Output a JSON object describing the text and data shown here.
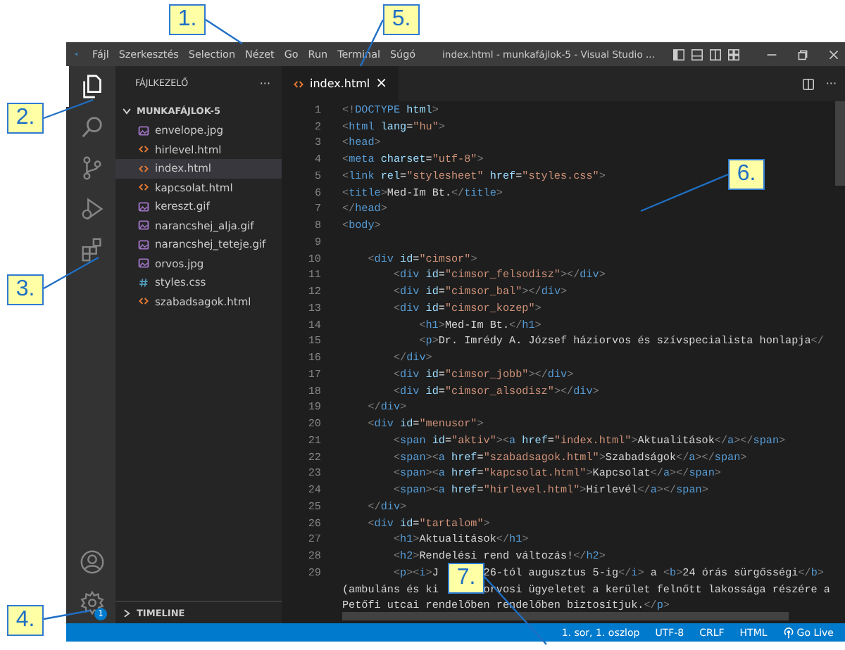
{
  "title_bar": {
    "menus": [
      "Fájl",
      "Szerkesztés",
      "Selection",
      "Nézet",
      "Go",
      "Run",
      "Terminal",
      "Súgó"
    ],
    "title": "index.html - munkafájlok-5 - Visual Studio ..."
  },
  "activity_bar": {
    "items": [
      {
        "kind": "explorer",
        "selected": true
      },
      {
        "kind": "search",
        "selected": false
      },
      {
        "kind": "source-control",
        "selected": false
      },
      {
        "kind": "run",
        "selected": false
      },
      {
        "kind": "extensions",
        "selected": false
      }
    ],
    "badge": "1"
  },
  "sidebar": {
    "title": "FÁJLKEZELŐ",
    "more": "···",
    "folder": {
      "name": "MUNKAFÁJLOK-5",
      "expanded": true,
      "files": [
        {
          "name": "envelope.jpg",
          "kind": "image",
          "selected": false
        },
        {
          "name": "hirlevel.html",
          "kind": "html",
          "selected": false
        },
        {
          "name": "index.html",
          "kind": "html",
          "selected": true
        },
        {
          "name": "kapcsolat.html",
          "kind": "html",
          "selected": false
        },
        {
          "name": "kereszt.gif",
          "kind": "image",
          "selected": false
        },
        {
          "name": "narancshej_alja.gif",
          "kind": "image",
          "selected": false
        },
        {
          "name": "narancshej_teteje.gif",
          "kind": "image",
          "selected": false
        },
        {
          "name": "orvos.jpg",
          "kind": "image",
          "selected": false
        },
        {
          "name": "styles.css",
          "kind": "css",
          "selected": false
        },
        {
          "name": "szabadsagok.html",
          "kind": "html",
          "selected": false
        }
      ]
    },
    "timeline": {
      "label": "TIMELINE",
      "expanded": false
    }
  },
  "tabs": [
    {
      "label": "index.html",
      "selected": true,
      "close": "×"
    }
  ],
  "editor_more": "···",
  "code_lines": [
    {
      "number": "1",
      "parts": [
        "<!DOCTYPE html>"
      ]
    },
    {
      "number": "2",
      "parts": [
        "<html lang=\"hu\">"
      ]
    },
    {
      "number": "3",
      "parts": [
        "<head>"
      ]
    },
    {
      "number": "4",
      "parts": [
        "<meta charset=\"utf-8\">"
      ]
    },
    {
      "number": "5",
      "parts": [
        "<link rel=\"stylesheet\" href=\"styles.css\">"
      ]
    },
    {
      "number": "6",
      "parts": [
        "<title>Med-Im Bt.</title>"
      ]
    },
    {
      "number": "7",
      "parts": [
        "</head>"
      ]
    },
    {
      "number": "8",
      "parts": [
        "<body>"
      ]
    },
    {
      "number": "9"
    },
    {
      "number": "10",
      "parts": [
        "    <div id=\"cimsor\">"
      ]
    },
    {
      "number": "11",
      "parts": [
        "        <div id=\"cimsor_felsodisz\"></div>"
      ]
    },
    {
      "number": "12",
      "parts": [
        "        <div id=\"cimsor_bal\"></div>"
      ]
    },
    {
      "number": "13",
      "parts": [
        "        <div id=\"cimsor_kozep\">"
      ]
    },
    {
      "number": "14",
      "parts": [
        "            <h1>Med-Im Bt.</h1>"
      ]
    },
    {
      "number": "15",
      "parts": [
        "            <p>Dr. Imrédy A. József háziorvos és szívspecialista honlapja</"
      ]
    },
    {
      "number": "16",
      "parts": [
        "        </div>"
      ]
    },
    {
      "number": "17",
      "parts": [
        "        <div id=\"cimsor_jobb\"></div>"
      ]
    },
    {
      "number": "18",
      "parts": [
        "        <div id=\"cimsor_alsodisz\"></div>"
      ]
    },
    {
      "number": "19",
      "parts": [
        "    </div>"
      ]
    },
    {
      "number": "20",
      "parts": [
        "    <div id=\"menusor\">"
      ]
    },
    {
      "number": "21",
      "parts": [
        "        <span id=\"aktiv\"><a href=\"index.html\">Aktualitások</a></span>"
      ]
    },
    {
      "number": "22",
      "parts": [
        "        <span><a href=\"szabadsagok.html\">Szabadságok</a></span>"
      ]
    },
    {
      "number": "23",
      "parts": [
        "        <span><a href=\"kapcsolat.html\">Kapcsolat</a></span>"
      ]
    },
    {
      "number": "24",
      "parts": [
        "        <span><a href=\"hirlevel.html\">Hírlevél</a></span>"
      ]
    },
    {
      "number": "25",
      "parts": [
        "    </div>"
      ]
    },
    {
      "number": "26",
      "parts": [
        "    <div id=\"tartalom\">"
      ]
    },
    {
      "number": "27",
      "parts": [
        "        <h1>Aktualitások</h1>"
      ]
    },
    {
      "number": "28",
      "parts": [
        "        <h2>Rendelési rend változás!</h2>"
      ]
    },
    {
      "number": "29",
      "parts": [
        "        <p><i>J",
        "26-tól augusztus 5-ig</i> a <b>24 órás sürgősségi</b>"
      ]
    },
    {
      "parts": [
        "(ambuláns és ki",
        "orvosi ügyeletet a kerület felnőtt lakossága részére a"
      ]
    },
    {
      "parts": [
        "Petőfi utcai rendelőben rendelőben biztosítjuk.</p>"
      ]
    }
  ],
  "status_bar": {
    "items": [
      "1. sor, 1. oszlop",
      "UTF-8",
      "CRLF",
      "HTML"
    ],
    "go_live": "Go Live"
  },
  "callouts": [
    {
      "label": "1."
    },
    {
      "label": "5."
    },
    {
      "label": "2."
    },
    {
      "label": "3."
    },
    {
      "label": "4."
    },
    {
      "label": "6."
    },
    {
      "label": "7."
    }
  ]
}
